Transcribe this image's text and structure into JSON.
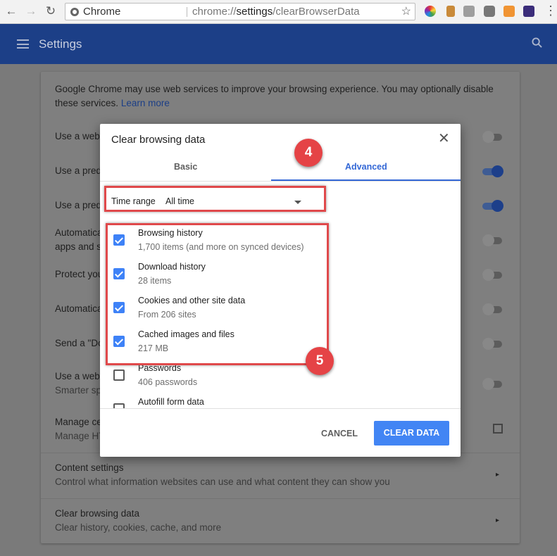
{
  "browser": {
    "site_name": "Chrome",
    "url_prefix": "chrome://",
    "url_bold": "settings",
    "url_suffix": "/clearBrowserData"
  },
  "header": {
    "title": "Settings"
  },
  "settings": {
    "intro_text": "Google Chrome may use web services to improve your browsing experience. You may optionally disable these services.",
    "learn_more": "Learn more",
    "rows": [
      {
        "label": "Use a web",
        "toggle": "off"
      },
      {
        "label": "Use a predi",
        "toggle": "on"
      },
      {
        "label": "Use a predi",
        "toggle": "on"
      },
      {
        "label": "Automatica",
        "sub": "apps and s",
        "toggle": "off"
      },
      {
        "label": "Protect you",
        "toggle": "off"
      },
      {
        "label": "Automatica",
        "toggle": "off"
      },
      {
        "label": "Send a \"Do",
        "toggle": "off"
      },
      {
        "label": "Use a web",
        "sub": "Smarter sp",
        "toggle": "off"
      }
    ],
    "manage_certs": {
      "label": "Manage ce",
      "sub": "Manage HT"
    },
    "content_settings": {
      "label": "Content settings",
      "sub": "Control what information websites can use and what content they can show you"
    },
    "clear_data": {
      "label": "Clear browsing data",
      "sub": "Clear history, cookies, cache, and more"
    }
  },
  "dialog": {
    "title": "Clear browsing data",
    "tabs": {
      "basic": "Basic",
      "advanced": "Advanced"
    },
    "active_tab": "Advanced",
    "time_range": {
      "label": "Time range",
      "value": "All time"
    },
    "items": [
      {
        "title": "Browsing history",
        "sub": "1,700 items (and more on synced devices)",
        "checked": true
      },
      {
        "title": "Download history",
        "sub": "28 items",
        "checked": true
      },
      {
        "title": "Cookies and other site data",
        "sub": "From 206 sites",
        "checked": true
      },
      {
        "title": "Cached images and files",
        "sub": "217 MB",
        "checked": true
      },
      {
        "title": "Passwords",
        "sub": "406 passwords",
        "checked": false
      },
      {
        "title": "Autofill form data",
        "sub": "",
        "checked": false
      }
    ],
    "cancel_label": "CANCEL",
    "clear_label": "CLEAR DATA"
  },
  "annotations": {
    "badge_4": "4",
    "badge_5": "5"
  },
  "colors": {
    "header_blue": "#1c3f87",
    "accent_blue": "#4285f4",
    "annotation_red": "#e54346"
  }
}
